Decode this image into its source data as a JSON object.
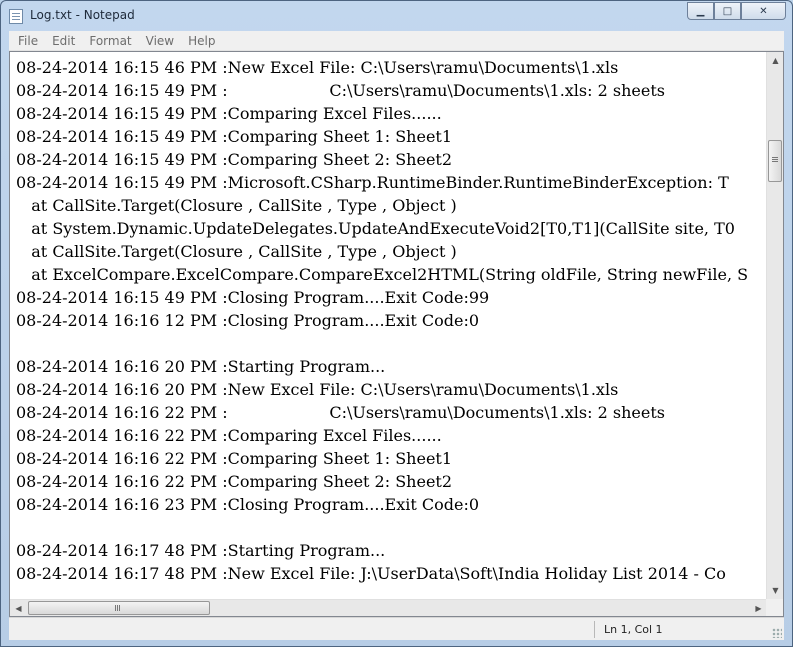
{
  "window": {
    "title": "Log.txt - Notepad",
    "minimize_glyph": "▁",
    "maximize_glyph": "□",
    "close_glyph": "✕"
  },
  "menu": [
    "File",
    "Edit",
    "Format",
    "View",
    "Help"
  ],
  "content": {
    "lines": [
      "08-24-2014 16:15 46 PM :New Excel File: C:\\Users\\ramu\\Documents\\1.xls",
      "08-24-2014 16:15 49 PM :                    C:\\Users\\ramu\\Documents\\1.xls: 2 sheets",
      "08-24-2014 16:15 49 PM :Comparing Excel Files......",
      "08-24-2014 16:15 49 PM :Comparing Sheet 1: Sheet1",
      "08-24-2014 16:15 49 PM :Comparing Sheet 2: Sheet2",
      "08-24-2014 16:15 49 PM :Microsoft.CSharp.RuntimeBinder.RuntimeBinderException: T",
      "   at CallSite.Target(Closure , CallSite , Type , Object )",
      "   at System.Dynamic.UpdateDelegates.UpdateAndExecuteVoid2[T0,T1](CallSite site, T0",
      "   at CallSite.Target(Closure , CallSite , Type , Object )",
      "   at ExcelCompare.ExcelCompare.CompareExcel2HTML(String oldFile, String newFile, S",
      "08-24-2014 16:15 49 PM :Closing Program....Exit Code:99",
      "08-24-2014 16:16 12 PM :Closing Program....Exit Code:0",
      "",
      "08-24-2014 16:16 20 PM :Starting Program...",
      "08-24-2014 16:16 20 PM :New Excel File: C:\\Users\\ramu\\Documents\\1.xls",
      "08-24-2014 16:16 22 PM :                    C:\\Users\\ramu\\Documents\\1.xls: 2 sheets",
      "08-24-2014 16:16 22 PM :Comparing Excel Files......",
      "08-24-2014 16:16 22 PM :Comparing Sheet 1: Sheet1",
      "08-24-2014 16:16 22 PM :Comparing Sheet 2: Sheet2",
      "08-24-2014 16:16 23 PM :Closing Program....Exit Code:0",
      "",
      "08-24-2014 16:17 48 PM :Starting Program...",
      "08-24-2014 16:17 48 PM :New Excel File: J:\\UserData\\Soft\\India Holiday List 2014 - Co"
    ]
  },
  "scrollbars": {
    "up_glyph": "▲",
    "down_glyph": "▼",
    "left_glyph": "◀",
    "right_glyph": "▶"
  },
  "status": {
    "position": "Ln 1, Col 1"
  }
}
